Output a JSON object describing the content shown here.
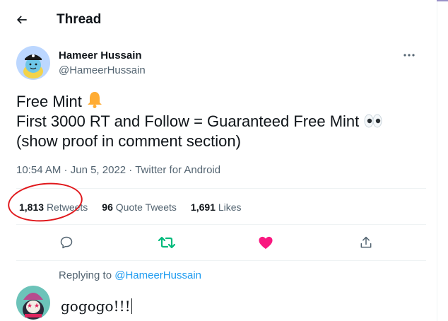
{
  "header": {
    "title": "Thread",
    "back_icon": "arrow-left-icon"
  },
  "author": {
    "name": "Hameer Hussain",
    "handle": "@HameerHussain",
    "avatar_bg": "#bcd7ff"
  },
  "tweet": {
    "line1": "Free Mint",
    "line1_emoji": "bell-icon",
    "line2": "First 3000 RT and Follow  = Guaranteed Free Mint",
    "line2_emoji": "eyes-icon",
    "line3": "(show proof in comment section)"
  },
  "meta": {
    "time": "10:54 AM",
    "sep1": " · ",
    "date": "Jun 5, 2022",
    "sep2": " · ",
    "source": "Twitter for Android"
  },
  "stats": {
    "retweets_count": "1,813",
    "retweets_label": "Retweets",
    "quotes_count": "96",
    "quotes_label": "Quote Tweets",
    "likes_count": "1,691",
    "likes_label": "Likes"
  },
  "actions": {
    "reply_icon": "reply-icon",
    "retweet_icon": "retweet-icon",
    "like_icon": "heart-icon",
    "share_icon": "share-icon",
    "retweet_color": "#00ba7c",
    "like_color": "#f91880"
  },
  "reply": {
    "replying_prefix": "Replying to ",
    "replying_mention": "@HameerHussain",
    "input_value": "gogogo!!!"
  },
  "colors": {
    "accent": "#1d9bf0",
    "secondary_text": "#536471",
    "annotation": "#e0181c"
  }
}
